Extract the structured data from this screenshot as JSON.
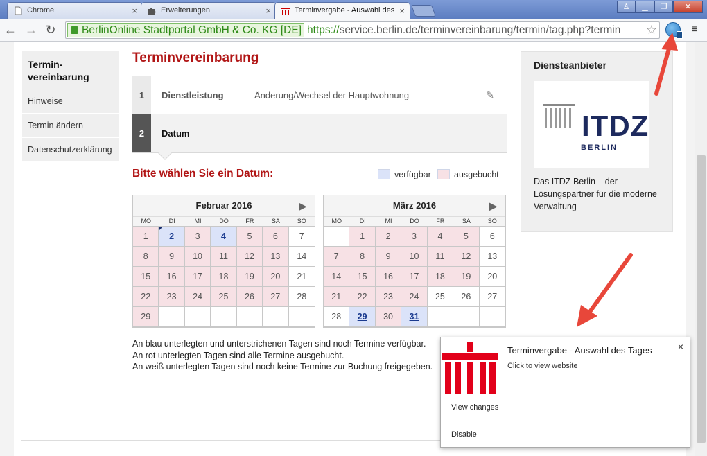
{
  "tabs": [
    {
      "title": "Chrome",
      "icon": "document-icon"
    },
    {
      "title": "Erweiterungen",
      "icon": "puzzle-icon"
    },
    {
      "title": "Terminvergabe - Auswahl des",
      "icon": "berlin-logo-icon"
    }
  ],
  "address": {
    "ev_cert": "BerlinOnline Stadtportal GmbH & Co. KG [DE]",
    "scheme": "https://",
    "url": "service.berlin.de/terminvereinbarung/termin/tag.php?termin"
  },
  "sidebar": {
    "items": [
      {
        "label": "Termin-vereinbarung"
      },
      {
        "label": "Hinweise"
      },
      {
        "label": "Termin ändern"
      },
      {
        "label": "Datenschutzerklärung"
      }
    ]
  },
  "main": {
    "title": "Terminvereinbarung",
    "steps": [
      {
        "num": "1",
        "label": "Dienstleistung",
        "value": "Änderung/Wechsel der Hauptwohnung"
      },
      {
        "num": "2",
        "label": "Datum"
      }
    ],
    "choose_heading": "Bitte wählen Sie ein Datum:",
    "legend": {
      "available": "verfügbar",
      "booked": "ausgebucht",
      "available_color": "#dbe3f9",
      "booked_color": "#f7e1e5"
    },
    "weekdays": [
      "MO",
      "DI",
      "MI",
      "DO",
      "FR",
      "SA",
      "SO"
    ],
    "calendars": [
      {
        "month": "Februar 2016",
        "days": [
          {
            "d": "1",
            "s": "booked"
          },
          {
            "d": "2",
            "s": "avail"
          },
          {
            "d": "3",
            "s": "booked"
          },
          {
            "d": "4",
            "s": "avail"
          },
          {
            "d": "5",
            "s": "booked"
          },
          {
            "d": "6",
            "s": "booked"
          },
          {
            "d": "7",
            "s": "free"
          },
          {
            "d": "8",
            "s": "booked"
          },
          {
            "d": "9",
            "s": "booked"
          },
          {
            "d": "10",
            "s": "booked"
          },
          {
            "d": "11",
            "s": "booked"
          },
          {
            "d": "12",
            "s": "booked"
          },
          {
            "d": "13",
            "s": "booked"
          },
          {
            "d": "14",
            "s": "free"
          },
          {
            "d": "15",
            "s": "booked"
          },
          {
            "d": "16",
            "s": "booked"
          },
          {
            "d": "17",
            "s": "booked"
          },
          {
            "d": "18",
            "s": "booked"
          },
          {
            "d": "19",
            "s": "booked"
          },
          {
            "d": "20",
            "s": "booked"
          },
          {
            "d": "21",
            "s": "free"
          },
          {
            "d": "22",
            "s": "booked"
          },
          {
            "d": "23",
            "s": "booked"
          },
          {
            "d": "24",
            "s": "booked"
          },
          {
            "d": "25",
            "s": "booked"
          },
          {
            "d": "26",
            "s": "booked"
          },
          {
            "d": "27",
            "s": "booked"
          },
          {
            "d": "28",
            "s": "free"
          },
          {
            "d": "29",
            "s": "booked"
          },
          {
            "d": "",
            "s": "empty"
          },
          {
            "d": "",
            "s": "empty"
          },
          {
            "d": "",
            "s": "empty"
          },
          {
            "d": "",
            "s": "empty"
          },
          {
            "d": "",
            "s": "empty"
          },
          {
            "d": "",
            "s": "empty"
          }
        ]
      },
      {
        "month": "März 2016",
        "days": [
          {
            "d": "",
            "s": "empty"
          },
          {
            "d": "1",
            "s": "booked"
          },
          {
            "d": "2",
            "s": "booked"
          },
          {
            "d": "3",
            "s": "booked"
          },
          {
            "d": "4",
            "s": "booked"
          },
          {
            "d": "5",
            "s": "booked"
          },
          {
            "d": "6",
            "s": "free"
          },
          {
            "d": "7",
            "s": "booked"
          },
          {
            "d": "8",
            "s": "booked"
          },
          {
            "d": "9",
            "s": "booked"
          },
          {
            "d": "10",
            "s": "booked"
          },
          {
            "d": "11",
            "s": "booked"
          },
          {
            "d": "12",
            "s": "booked"
          },
          {
            "d": "13",
            "s": "free"
          },
          {
            "d": "14",
            "s": "booked"
          },
          {
            "d": "15",
            "s": "booked"
          },
          {
            "d": "16",
            "s": "booked"
          },
          {
            "d": "17",
            "s": "booked"
          },
          {
            "d": "18",
            "s": "booked"
          },
          {
            "d": "19",
            "s": "booked"
          },
          {
            "d": "20",
            "s": "free"
          },
          {
            "d": "21",
            "s": "booked"
          },
          {
            "d": "22",
            "s": "booked"
          },
          {
            "d": "23",
            "s": "booked"
          },
          {
            "d": "24",
            "s": "booked"
          },
          {
            "d": "25",
            "s": "free"
          },
          {
            "d": "26",
            "s": "free"
          },
          {
            "d": "27",
            "s": "free"
          },
          {
            "d": "28",
            "s": "free"
          },
          {
            "d": "29",
            "s": "avail"
          },
          {
            "d": "30",
            "s": "booked"
          },
          {
            "d": "31",
            "s": "avail"
          },
          {
            "d": "",
            "s": "empty"
          },
          {
            "d": "",
            "s": "empty"
          },
          {
            "d": "",
            "s": "empty"
          }
        ]
      }
    ],
    "info_lines": [
      "An blau unterlegten und unterstrichenen Tagen sind noch Termine verfügbar.",
      "An rot unterlegten Tagen sind alle Termine ausgebucht.",
      "An weiß unterlegten Tagen sind noch keine Termine zur Buchung freigegeben."
    ]
  },
  "provider": {
    "title": "Diensteanbieter",
    "logo_text": "ITDZ",
    "logo_sub": "BERLIN",
    "description": "Das ITDZ Berlin – der Lösungspartner für die moderne Verwaltung"
  },
  "notification": {
    "title": "Terminvergabe - Auswahl des Tages",
    "subtitle": "Click to view website",
    "buttons": [
      "View changes",
      "Disable"
    ],
    "close": "×"
  },
  "colors": {
    "accent_red": "#b11515",
    "arrow_red": "#e8473a"
  }
}
